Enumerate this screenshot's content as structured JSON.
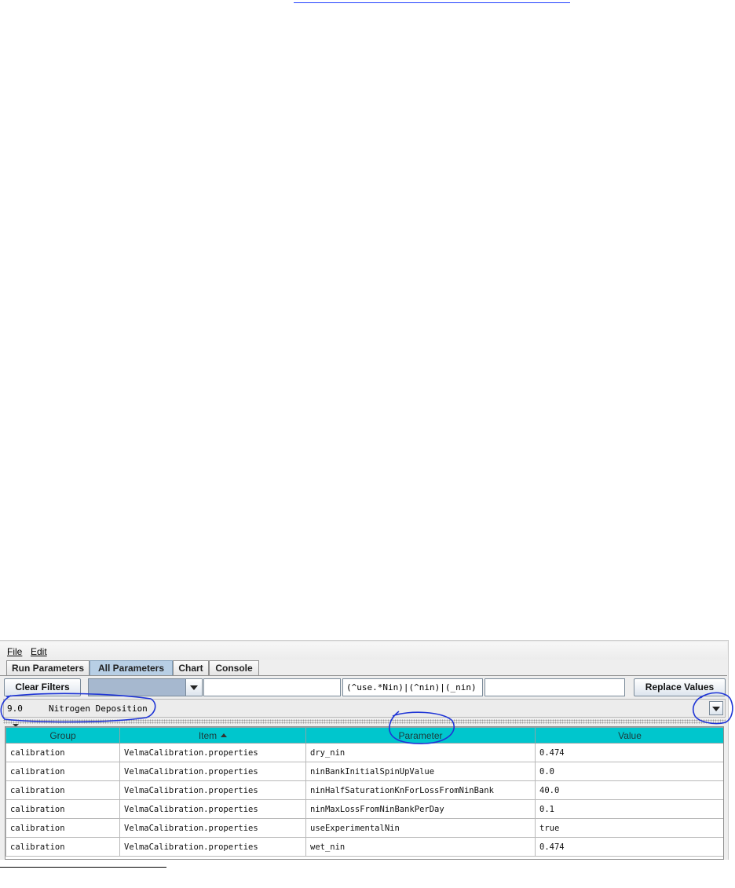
{
  "menu": {
    "file": "File",
    "edit": "Edit"
  },
  "tabs": [
    {
      "label": "Run Parameters",
      "active": false
    },
    {
      "label": "All Parameters",
      "active": true
    },
    {
      "label": "Chart",
      "active": false
    },
    {
      "label": "Console",
      "active": false
    }
  ],
  "toolbar": {
    "clear_filters_label": "Clear Filters",
    "filter_text": "",
    "regex_filter": "(^use.*Nin)|(^nin)|(_nin)",
    "replace_value": "",
    "replace_values_label": "Replace Values"
  },
  "section_selector": {
    "value": "9.0     Nitrogen Deposition"
  },
  "table": {
    "columns": [
      "Group",
      "Item",
      "Parameter",
      "Value"
    ],
    "sorted_column": "Item",
    "rows": [
      [
        "calibration",
        "VelmaCalibration.properties",
        "dry_nin",
        "0.474"
      ],
      [
        "calibration",
        "VelmaCalibration.properties",
        "ninBankInitialSpinUpValue",
        "0.0"
      ],
      [
        "calibration",
        "VelmaCalibration.properties",
        "ninHalfSaturationKnForLossFromNinBank",
        "40.0"
      ],
      [
        "calibration",
        "VelmaCalibration.properties",
        "ninMaxLossFromNinBankPerDay",
        "0.1"
      ],
      [
        "calibration",
        "VelmaCalibration.properties",
        "useExperimentalNin",
        "true"
      ],
      [
        "calibration",
        "VelmaCalibration.properties",
        "wet_nin",
        "0.474"
      ]
    ]
  },
  "colors": {
    "header_bg": "#00c6cd",
    "active_tab": "#b8cfe5",
    "annotation": "#1f35d6"
  },
  "icons": {
    "combo_arrow": "triangle-down-icon",
    "sort": "sort-ascending-icon"
  }
}
